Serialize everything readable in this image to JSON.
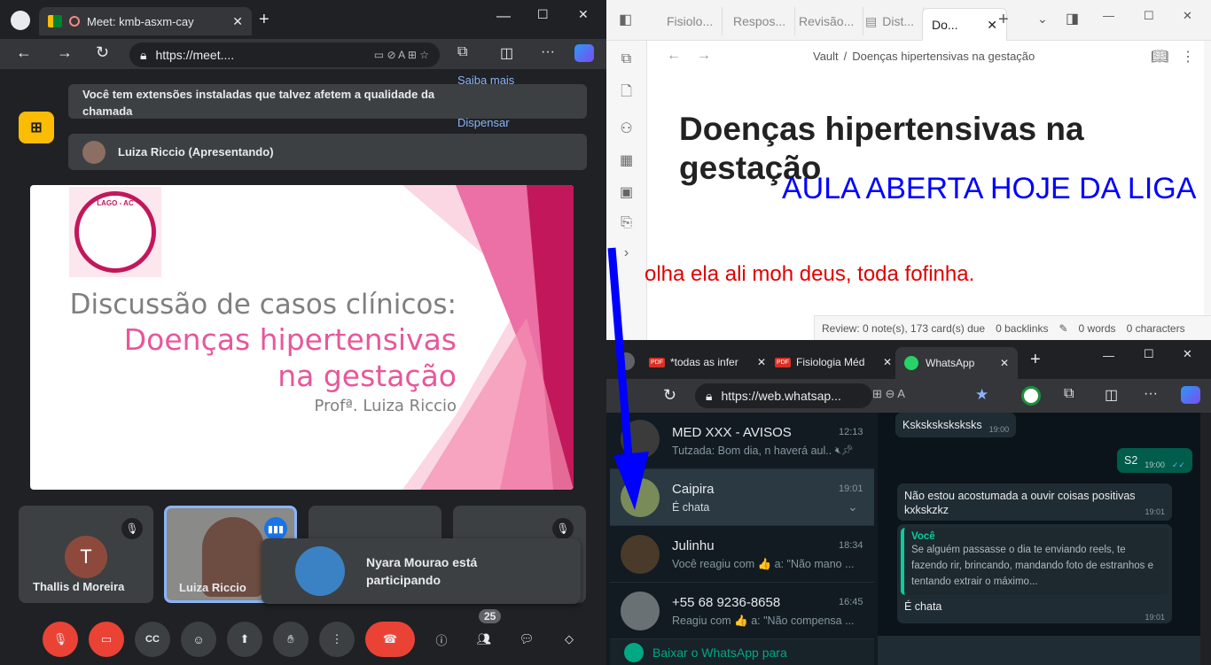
{
  "meet": {
    "tab_title": "Meet: kmb-asxm-cay",
    "url": "https://meet....",
    "banner_text": "Você tem extensões instaladas que talvez afetem a qualidade da chamada",
    "banner_learn_more": "Saiba mais",
    "banner_dismiss": "Dispensar",
    "presenting_label": "Luiza Riccio (Apresentando)",
    "slide": {
      "logo_text": "LAGO - AC",
      "line1": "Discussão de casos clínicos:",
      "line2": "Doenças hipertensivas",
      "line3": "na gestação",
      "author": "Profª. Luiza Riccio"
    },
    "participants": [
      {
        "initial": "T",
        "name": "Thallis d Moreira"
      },
      {
        "name": "Luiza Riccio"
      }
    ],
    "toast_text": "Nyara Mourao está participando",
    "people_count": "25"
  },
  "obsidian": {
    "tabs": [
      "Fisiolo...",
      "Respos...",
      "Revisão...",
      "Dist...",
      "Do..."
    ],
    "breadcrumb_root": "Vault",
    "breadcrumb_sep": "/",
    "breadcrumb_page": "Doenças hipertensivas na gestação",
    "title": "Doenças hipertensivas na gestação",
    "overlay_blue": "AULA ABERTA HOJE DA LIGA",
    "overlay_red": "olha ela ali moh deus, toda fofinha.",
    "status": {
      "review": "Review: 0 note(s), 173 card(s) due",
      "backlinks": "0 backlinks",
      "words": "0 words",
      "characters": "0 characters"
    }
  },
  "whatsapp": {
    "tabs": [
      "*todas as infer",
      "Fisiologia Méd",
      "WhatsApp"
    ],
    "url": "https://web.whatsap...",
    "chats": [
      {
        "name": "MED XXX - AVISOS",
        "time": "12:13",
        "preview": "Tutzada: Bom dia, n haverá aul..."
      },
      {
        "name": "Caipira",
        "time": "19:01",
        "preview": "É chata"
      },
      {
        "name": "Julinhu",
        "time": "18:34",
        "preview": "Você reagiu com 👍 a: \"Não mano ..."
      },
      {
        "name": "+55 68 9236-8658",
        "time": "16:45",
        "preview": "Reagiu com 👍 a: \"Não compensa ..."
      }
    ],
    "download_text": "Baixar o WhatsApp para",
    "messages": {
      "m1_text": "Ksksksksksksks",
      "m1_time": "19:00",
      "m2_text": "S2",
      "m2_time": "19:00",
      "m3_text": "Não estou acostumada a ouvir coisas positivas kxkskzkz",
      "m3_time": "19:01",
      "quote_author": "Você",
      "quote_text": "Se alguém passasse o dia te enviando reels, te fazendo rir, brincando, mandando foto de estranhos e tentando extrair o máximo...",
      "m4_text": "É chata",
      "m4_time": "19:01"
    }
  },
  "colors": {
    "meet_red": "#ea4335",
    "wa_green": "#005c4b",
    "arrow_blue": "#0000ff",
    "slide_pink": "#e8579a"
  }
}
